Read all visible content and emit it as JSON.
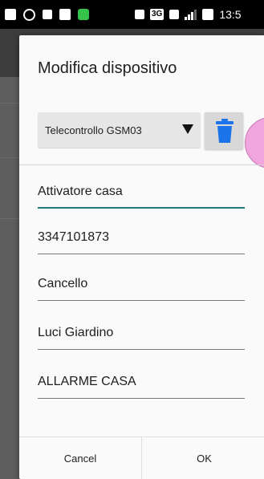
{
  "status_bar": {
    "network": "3G",
    "time": "13:5"
  },
  "dialog": {
    "title": "Modifica dispositivo",
    "device_selector": {
      "selected": "Telecontrollo GSM03"
    },
    "fields": [
      {
        "value": "Attivatore casa",
        "focused": true
      },
      {
        "value": "3347101873"
      },
      {
        "value": "Cancello"
      },
      {
        "value": "Luci Giardino"
      },
      {
        "value": "ALLARME CASA"
      }
    ],
    "buttons": {
      "cancel": "Cancel",
      "ok": "OK"
    }
  },
  "colors": {
    "accent": "#1f7a73",
    "trash": "#1a73e8",
    "bubble": "#f0a5de"
  }
}
